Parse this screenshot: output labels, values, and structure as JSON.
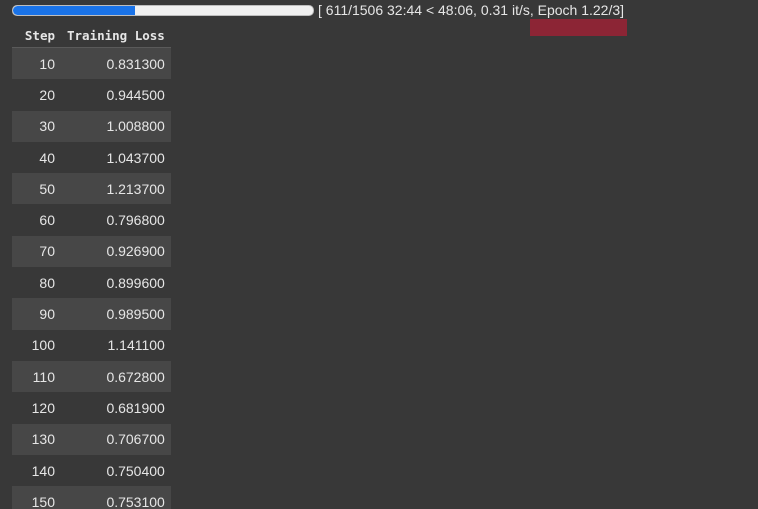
{
  "progress": {
    "fraction": 0.4057,
    "text": "[ 611/1506 32:44 < 48:06, 0.31 it/s, Epoch 1.22/3]",
    "fill_color": "#1a73e8"
  },
  "highlight_color": "#8c2535",
  "table": {
    "headers": [
      "Step",
      "Training Loss"
    ],
    "rows": [
      {
        "step": "10",
        "loss": "0.831300"
      },
      {
        "step": "20",
        "loss": "0.944500"
      },
      {
        "step": "30",
        "loss": "1.008800"
      },
      {
        "step": "40",
        "loss": "1.043700"
      },
      {
        "step": "50",
        "loss": "1.213700"
      },
      {
        "step": "60",
        "loss": "0.796800"
      },
      {
        "step": "70",
        "loss": "0.926900"
      },
      {
        "step": "80",
        "loss": "0.899600"
      },
      {
        "step": "90",
        "loss": "0.989500"
      },
      {
        "step": "100",
        "loss": "1.141100"
      },
      {
        "step": "110",
        "loss": "0.672800"
      },
      {
        "step": "120",
        "loss": "0.681900"
      },
      {
        "step": "130",
        "loss": "0.706700"
      },
      {
        "step": "140",
        "loss": "0.750400"
      },
      {
        "step": "150",
        "loss": "0.753100"
      }
    ]
  }
}
